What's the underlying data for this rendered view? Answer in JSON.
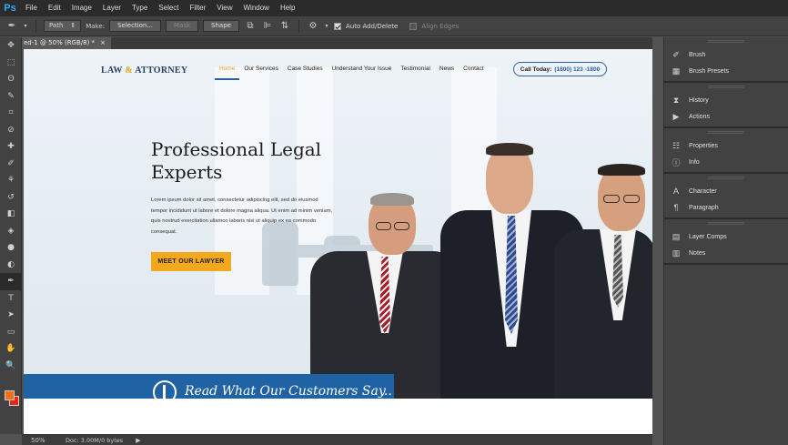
{
  "menubar": {
    "logo": "Ps",
    "items": [
      "File",
      "Edit",
      "Image",
      "Layer",
      "Type",
      "Select",
      "Filter",
      "View",
      "Window",
      "Help"
    ]
  },
  "options": {
    "tool_icon": "pen-tool-icon",
    "mode_value": "Path",
    "make_label": "Make:",
    "selection_label": "Selection...",
    "mask_label": "Mask",
    "shape_label": "Shape",
    "auto_add_label": "Auto Add/Delete",
    "align_edges_label": "Align Edges",
    "auto_add_checked": true,
    "align_edges_checked": false
  },
  "document": {
    "tab_label": "ed-1 @ 50% (RGB/8) *",
    "close": "×"
  },
  "toolbar": {
    "tools": [
      "move-tool-icon",
      "marquee-tool-icon",
      "lasso-tool-icon",
      "quick-select-tool-icon",
      "crop-tool-icon",
      "eyedropper-tool-icon",
      "healing-brush-tool-icon",
      "brush-tool-icon",
      "clone-stamp-tool-icon",
      "history-brush-tool-icon",
      "eraser-tool-icon",
      "paint-bucket-tool-icon",
      "blur-tool-icon",
      "dodge-tool-icon",
      "pen-tool-icon",
      "type-tool-icon",
      "path-select-tool-icon",
      "rectangle-tool-icon",
      "hand-tool-icon",
      "zoom-tool-icon"
    ],
    "glyphs": [
      "✥",
      "⬚",
      "ʘ",
      "✎",
      "⌗",
      "⊘",
      "✚",
      "✐",
      "⚘",
      "↺",
      "◧",
      "◈",
      "●",
      "◐",
      "✒",
      "T",
      "➤",
      "▭",
      "✋",
      "🔍"
    ],
    "active_index": 14,
    "fg_color": "#f26f16",
    "bg_color": "#e8261c"
  },
  "site": {
    "logo_part1": "LAW ",
    "logo_amp": "&",
    "logo_part2": " ATTORNEY",
    "nav": [
      "Home",
      "Our Services",
      "Case Studies",
      "Understand Your Issue",
      "Testimonial",
      "News",
      "Contact"
    ],
    "nav_active": 0,
    "call_label": "Call Today:",
    "call_number": "(1800) 123 -1800",
    "headline_line1": "Professional Legal",
    "headline_line2": "Experts",
    "body": "Lorem ipsum dolor sit amet, consectetur adipiscing elit, sed do eiusmod tempor incididunt ut labore et dolore magna aliqua. Ut enim ad minim veniam, quis nostrud exercitation ullamco laboris nisi ut aliquip ex ea commodo consequat.",
    "cta_label": "MEET OUR  LAWYER",
    "banner_text": "Read What Our Customers Say.."
  },
  "status": {
    "zoom": "50%",
    "doc_info": "Doc: 3.00M/0 bytes",
    "arrow": "▶"
  },
  "panels": {
    "groups": [
      [
        {
          "icon": "brush-icon",
          "glyph": "✐",
          "label": "Brush"
        },
        {
          "icon": "brush-presets-icon",
          "glyph": "▦",
          "label": "Brush Presets"
        }
      ],
      [
        {
          "icon": "history-icon",
          "glyph": "⧗",
          "label": "History"
        },
        {
          "icon": "actions-icon",
          "glyph": "▶",
          "label": "Actions"
        }
      ],
      [
        {
          "icon": "properties-icon",
          "glyph": "☷",
          "label": "Properties"
        },
        {
          "icon": "info-icon",
          "glyph": "ⓘ",
          "label": "Info"
        }
      ],
      [
        {
          "icon": "character-icon",
          "glyph": "A",
          "label": "Character"
        },
        {
          "icon": "paragraph-icon",
          "glyph": "¶",
          "label": "Paragraph"
        }
      ],
      [
        {
          "icon": "layer-comps-icon",
          "glyph": "▤",
          "label": "Layer Comps"
        },
        {
          "icon": "notes-icon",
          "glyph": "▥",
          "label": "Notes"
        }
      ]
    ]
  }
}
